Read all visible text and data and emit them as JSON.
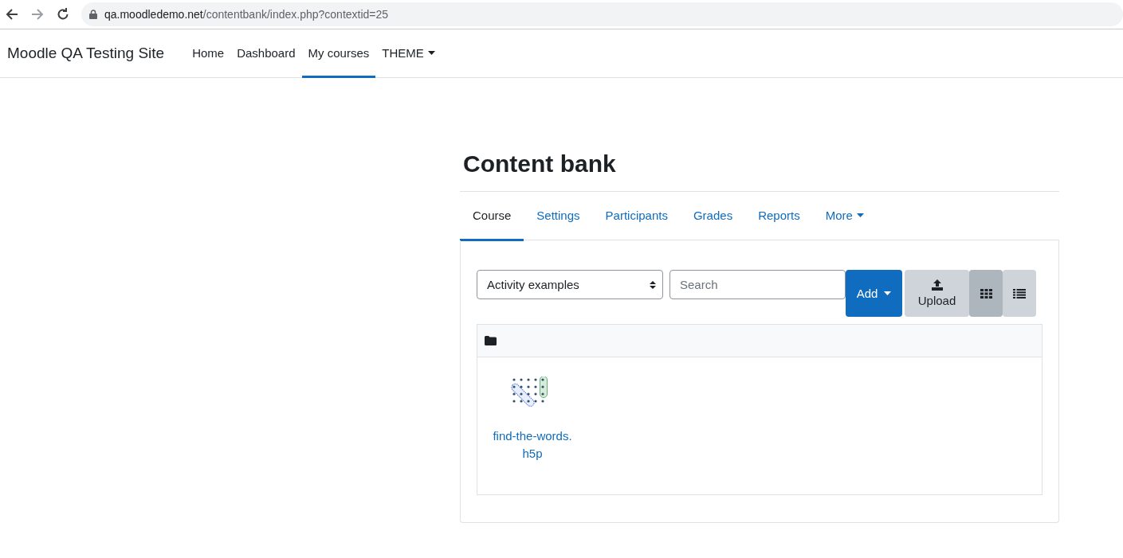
{
  "browser": {
    "url_host": "qa.moodledemo.net",
    "url_path": "/contentbank/index.php?contextid=25"
  },
  "site_name": "Moodle QA Testing Site",
  "nav": [
    {
      "label": "Home",
      "selected": false
    },
    {
      "label": "Dashboard",
      "selected": false
    },
    {
      "label": "My courses",
      "selected": true
    },
    {
      "label": "THEME",
      "selected": false,
      "kind": "dropdown"
    }
  ],
  "heading": "Content bank",
  "tabs": [
    {
      "label": "Course",
      "selected": true
    },
    {
      "label": "Settings",
      "selected": false
    },
    {
      "label": "Participants",
      "selected": false
    },
    {
      "label": "Grades",
      "selected": false
    },
    {
      "label": "Reports",
      "selected": false
    },
    {
      "label": "More",
      "selected": false,
      "kind": "dropdown"
    }
  ],
  "toolbar": {
    "context_select": "Activity examples",
    "search": {
      "placeholder": "Search"
    },
    "add_button": "Add",
    "upload_button": "Upload",
    "views": [
      {
        "kind": "grid",
        "selected": true
      },
      {
        "kind": "list",
        "selected": false
      }
    ]
  },
  "files": [
    {
      "name_line_1": "find-the-words.",
      "name_line_2": "h5p"
    }
  ]
}
